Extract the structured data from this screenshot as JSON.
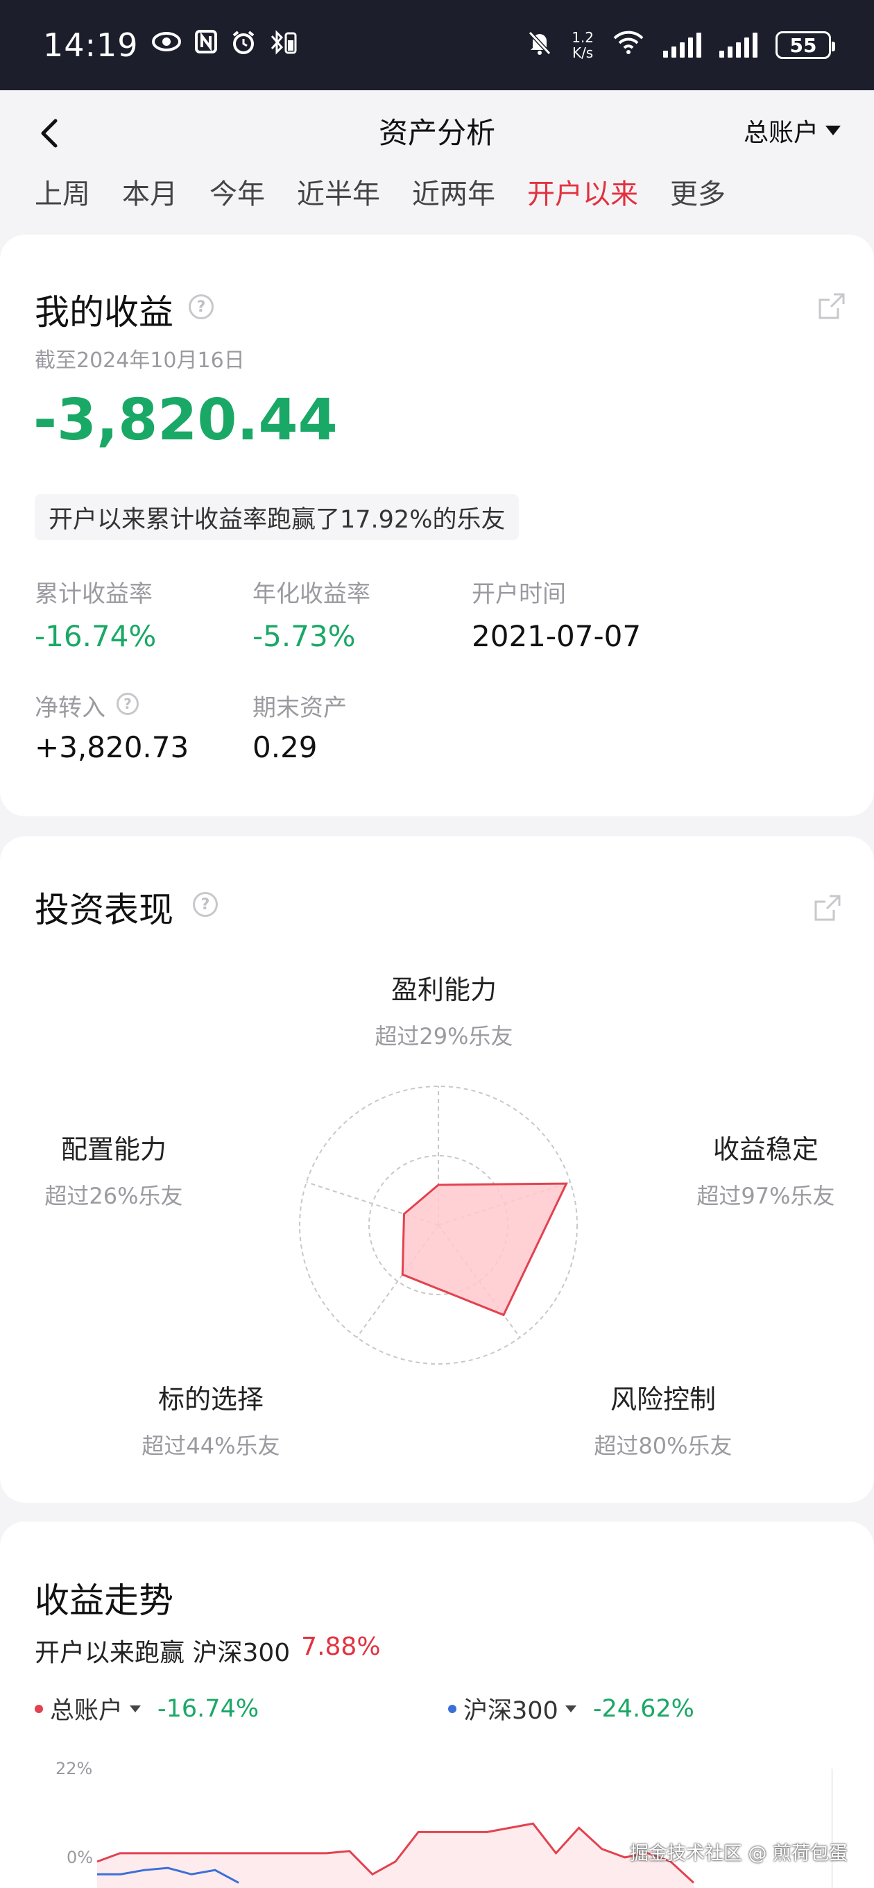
{
  "status_bar": {
    "time": "14:19",
    "net_speed_value": "1.2",
    "net_speed_unit": "K/s",
    "battery": "55"
  },
  "header": {
    "title": "资产分析",
    "account": "总账户"
  },
  "tabs": [
    "上周",
    "本月",
    "今年",
    "近半年",
    "近两年",
    "开户以来",
    "更多"
  ],
  "active_tab": "开户以来",
  "earnings": {
    "title": "我的收益",
    "as_of": "截至2024年10月16日",
    "amount": "-3,820.44",
    "beat_text": "开户以来累计收益率跑赢了17.92%的乐友",
    "stats": [
      {
        "label": "累计收益率",
        "value": "-16.74%"
      },
      {
        "label": "年化收益率",
        "value": "-5.73%"
      },
      {
        "label": "开户时间",
        "value": "2021-07-07"
      },
      {
        "label": "净转入",
        "value": "+3,820.73"
      },
      {
        "label": "期末资产",
        "value": "0.29"
      }
    ]
  },
  "performance": {
    "title": "投资表现",
    "axes": [
      {
        "name": "盈利能力",
        "desc": "超过29%乐友",
        "value": 29
      },
      {
        "name": "收益稳定",
        "desc": "超过97%乐友",
        "value": 97
      },
      {
        "name": "风险控制",
        "desc": "超过80%乐友",
        "value": 80
      },
      {
        "name": "标的选择",
        "desc": "超过44%乐友",
        "value": 44
      },
      {
        "name": "配置能力",
        "desc": "超过26%乐友",
        "value": 26
      }
    ],
    "colors": {
      "fill": "#ffc9ce",
      "stroke": "#e2424f",
      "grid": "#c8c8cc"
    }
  },
  "trend": {
    "title": "收益走势",
    "compare_label": "开户以来跑赢 沪深300",
    "compare_value": "7.88%",
    "legend": [
      {
        "name": "总账户",
        "value": "-16.74%",
        "color": "#e2424f"
      },
      {
        "name": "沪深300",
        "value": "-24.62%",
        "color": "#3b6fd8"
      }
    ],
    "y_ticks": [
      "22%",
      "0%"
    ],
    "watermark": "掘金技术社区 @ 煎荷包蛋"
  },
  "chart_data": {
    "type": "line",
    "ylim": [
      -5,
      22
    ],
    "series": [
      {
        "name": "总账户",
        "values": [
          0,
          2,
          2,
          2,
          2,
          2,
          2,
          2,
          2,
          2,
          2,
          2.5,
          -3,
          0,
          7,
          7,
          7,
          7,
          8,
          9,
          2,
          8,
          3,
          1,
          2,
          0,
          -5
        ]
      },
      {
        "name": "沪深300",
        "values": [
          -3,
          -3,
          -2,
          -1.5,
          -3,
          -2,
          -5
        ]
      }
    ]
  }
}
